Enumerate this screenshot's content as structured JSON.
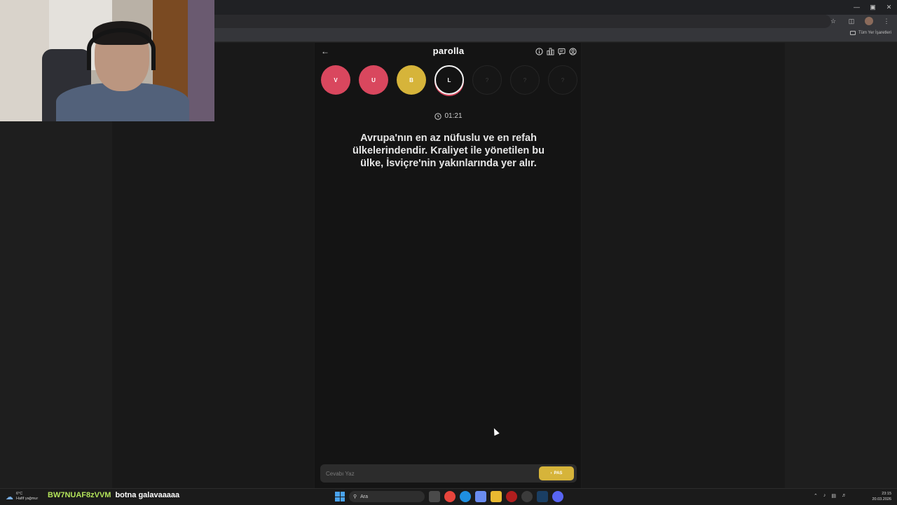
{
  "app": {
    "title": "parolla",
    "back_label": "←",
    "timer": "01:21",
    "question": "Avrupa'nın en az nüfuslu ve en refah ülkelerindendir. Kraliyet ile yönetilen bu ülke, İsviçre'nin yakınlarında yer alır.",
    "answer_placeholder": "Cevabı Yaz",
    "pass_label": "PAS",
    "letters": [
      {
        "label": "V",
        "state": "wrong"
      },
      {
        "label": "U",
        "state": "wrong"
      },
      {
        "label": "B",
        "state": "pass"
      },
      {
        "label": "L",
        "state": "current"
      },
      {
        "label": "?",
        "state": "pending"
      },
      {
        "label": "?",
        "state": "pending"
      },
      {
        "label": "?",
        "state": "pending"
      }
    ],
    "header_icons": [
      "info-icon",
      "stats-icon",
      "chat-icon",
      "profile-icon"
    ]
  },
  "browser": {
    "bookmarks_all": "Tüm Yer İşaretleri"
  },
  "chat": {
    "username": "BW7NUAF8zVVM",
    "message": "botna galavaaaaa"
  },
  "taskbar": {
    "weather_temp": "6°C",
    "weather_desc": "Hafif yağmur",
    "search_label": "Ara",
    "time": "23:15",
    "date": "20.03.2026"
  },
  "colors": {
    "wrong": "#d9475e",
    "pass": "#d6b43a",
    "background": "#141414"
  }
}
